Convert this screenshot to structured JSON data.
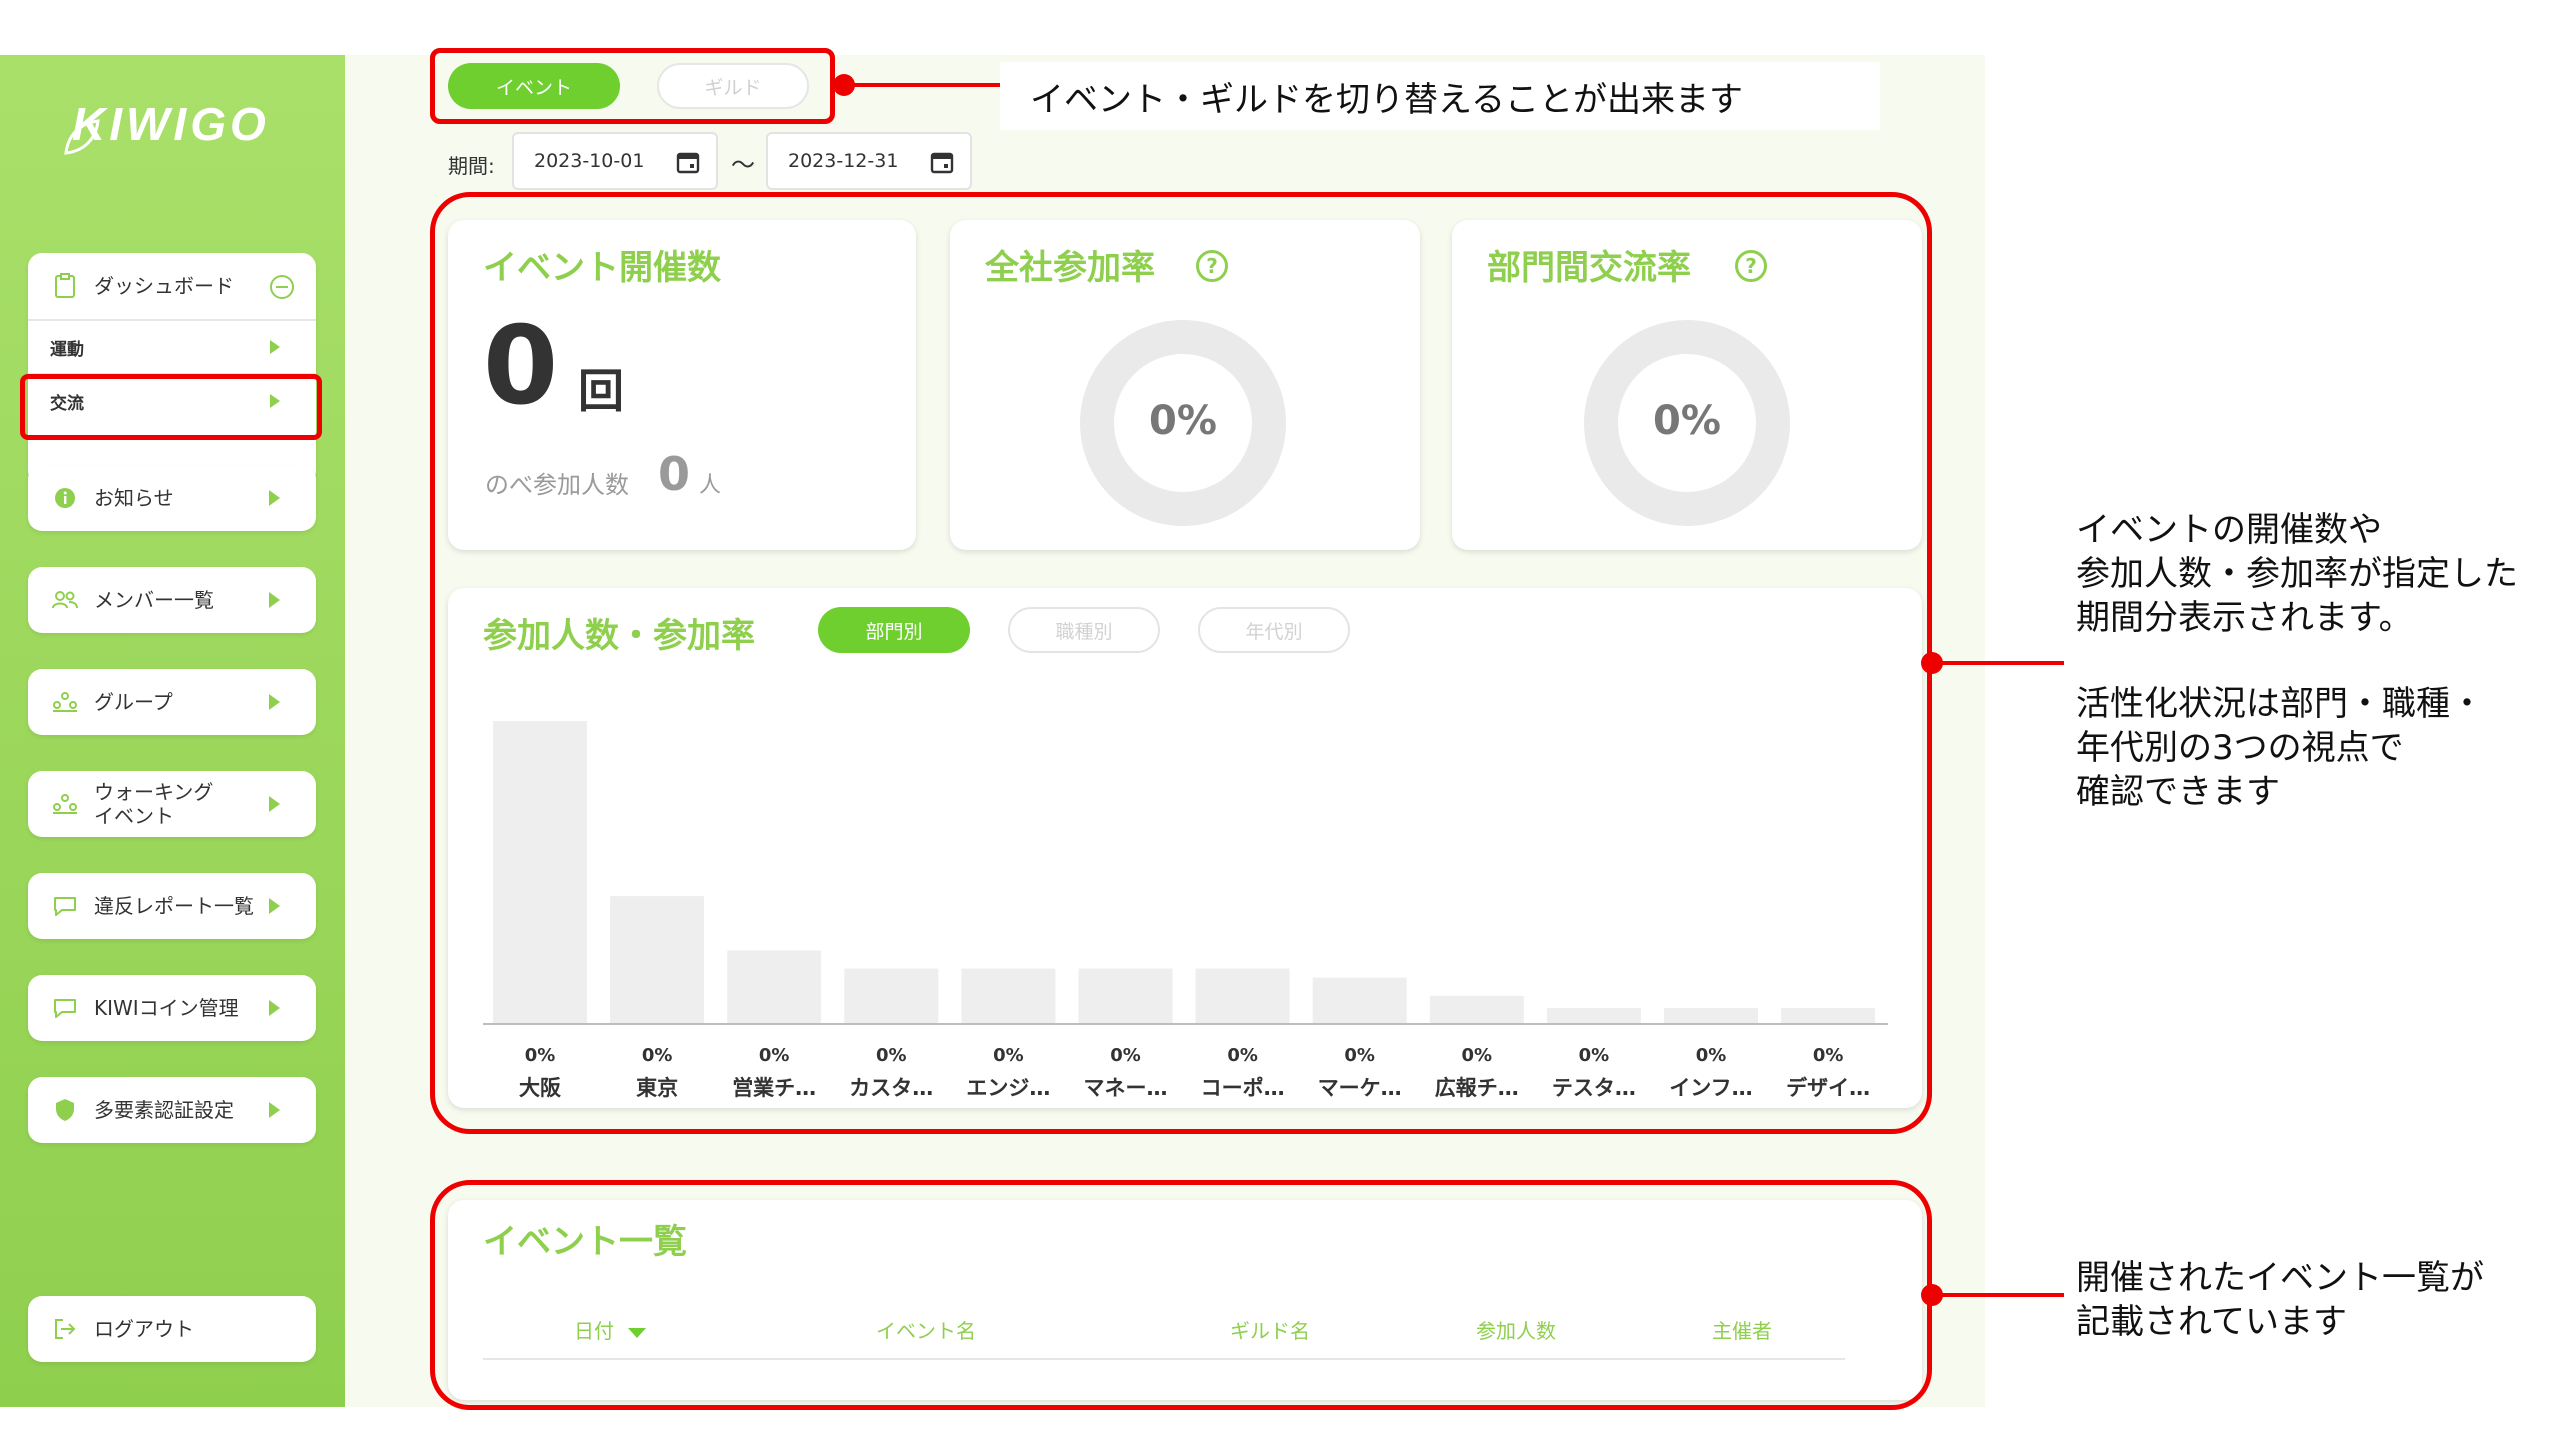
{
  "brand": {
    "logo_text": "KIWIGO"
  },
  "sidebar": {
    "dashboard": {
      "label": "ダッシュボード",
      "children": [
        {
          "label": "運動"
        },
        {
          "label": "交流"
        }
      ]
    },
    "items": [
      {
        "label": "お知らせ",
        "icon": "info-icon"
      },
      {
        "label": "メンバー一覧",
        "icon": "members-icon"
      },
      {
        "label": "グループ",
        "icon": "group-icon"
      },
      {
        "label": "ウォーキング\nイベント",
        "icon": "walking-event-icon"
      },
      {
        "label": "違反レポート一覧",
        "icon": "chat-bubble-icon"
      },
      {
        "label": "KIWIコイン管理",
        "icon": "chat-bubble-icon"
      },
      {
        "label": "多要素認証設定",
        "icon": "shield-icon"
      }
    ],
    "logout": {
      "label": "ログアウト"
    }
  },
  "tabs": {
    "event": "イベント",
    "guild": "ギルド",
    "active": "event"
  },
  "period": {
    "label": "期間:",
    "start": "2023-10-01",
    "end": "2023-12-31",
    "separator": "〜"
  },
  "stats": {
    "events": {
      "title": "イベント開催数",
      "value": "0",
      "unit": "回",
      "participants_label": "のべ参加人数",
      "participants_value": "0",
      "participants_unit": "人"
    },
    "company_rate": {
      "title": "全社参加率",
      "value": "0%"
    },
    "dept_exchange_rate": {
      "title": "部門間交流率",
      "value": "0%"
    }
  },
  "participation": {
    "title": "参加人数・参加率",
    "filters": [
      {
        "label": "部門別",
        "active": true
      },
      {
        "label": "職種別",
        "active": false
      },
      {
        "label": "年代別",
        "active": false
      }
    ]
  },
  "chart_data": {
    "type": "bar",
    "title": "",
    "categories": [
      "大阪",
      "東京",
      "営業チ…",
      "カスタ…",
      "エンジ…",
      "マネー…",
      "コーポ…",
      "マーケ…",
      "広報チ…",
      "テスタ…",
      "インフ…",
      "デザイ…"
    ],
    "values": [
      100,
      42,
      24,
      18,
      18,
      18,
      18,
      15,
      9,
      5,
      5,
      5
    ],
    "data_labels": [
      "0%",
      "0%",
      "0%",
      "0%",
      "0%",
      "0%",
      "0%",
      "0%",
      "0%",
      "0%",
      "0%",
      "0%"
    ],
    "ylim": [
      0,
      100
    ],
    "grid": false,
    "bar_color": "#eeeeee"
  },
  "event_list": {
    "title": "イベント一覧",
    "columns": [
      "日付",
      "イベント名",
      "ギルド名",
      "参加人数",
      "主催者"
    ]
  },
  "annotations": {
    "tabs_note": "イベント・ギルドを切り替えることが出来ます",
    "stats_note_1": "イベントの開催数や\n参加人数・参加率が指定した\n期間分表示されます。",
    "stats_note_2": "活性化状況は部門・職種・\n年代別の3つの視点で\n確認できます",
    "list_note": "開催されたイベント一覧が\n記載されています"
  },
  "colors": {
    "accent": "#8fcf4e",
    "active_button": "#6fcf2f",
    "annotation": "#e00000"
  }
}
